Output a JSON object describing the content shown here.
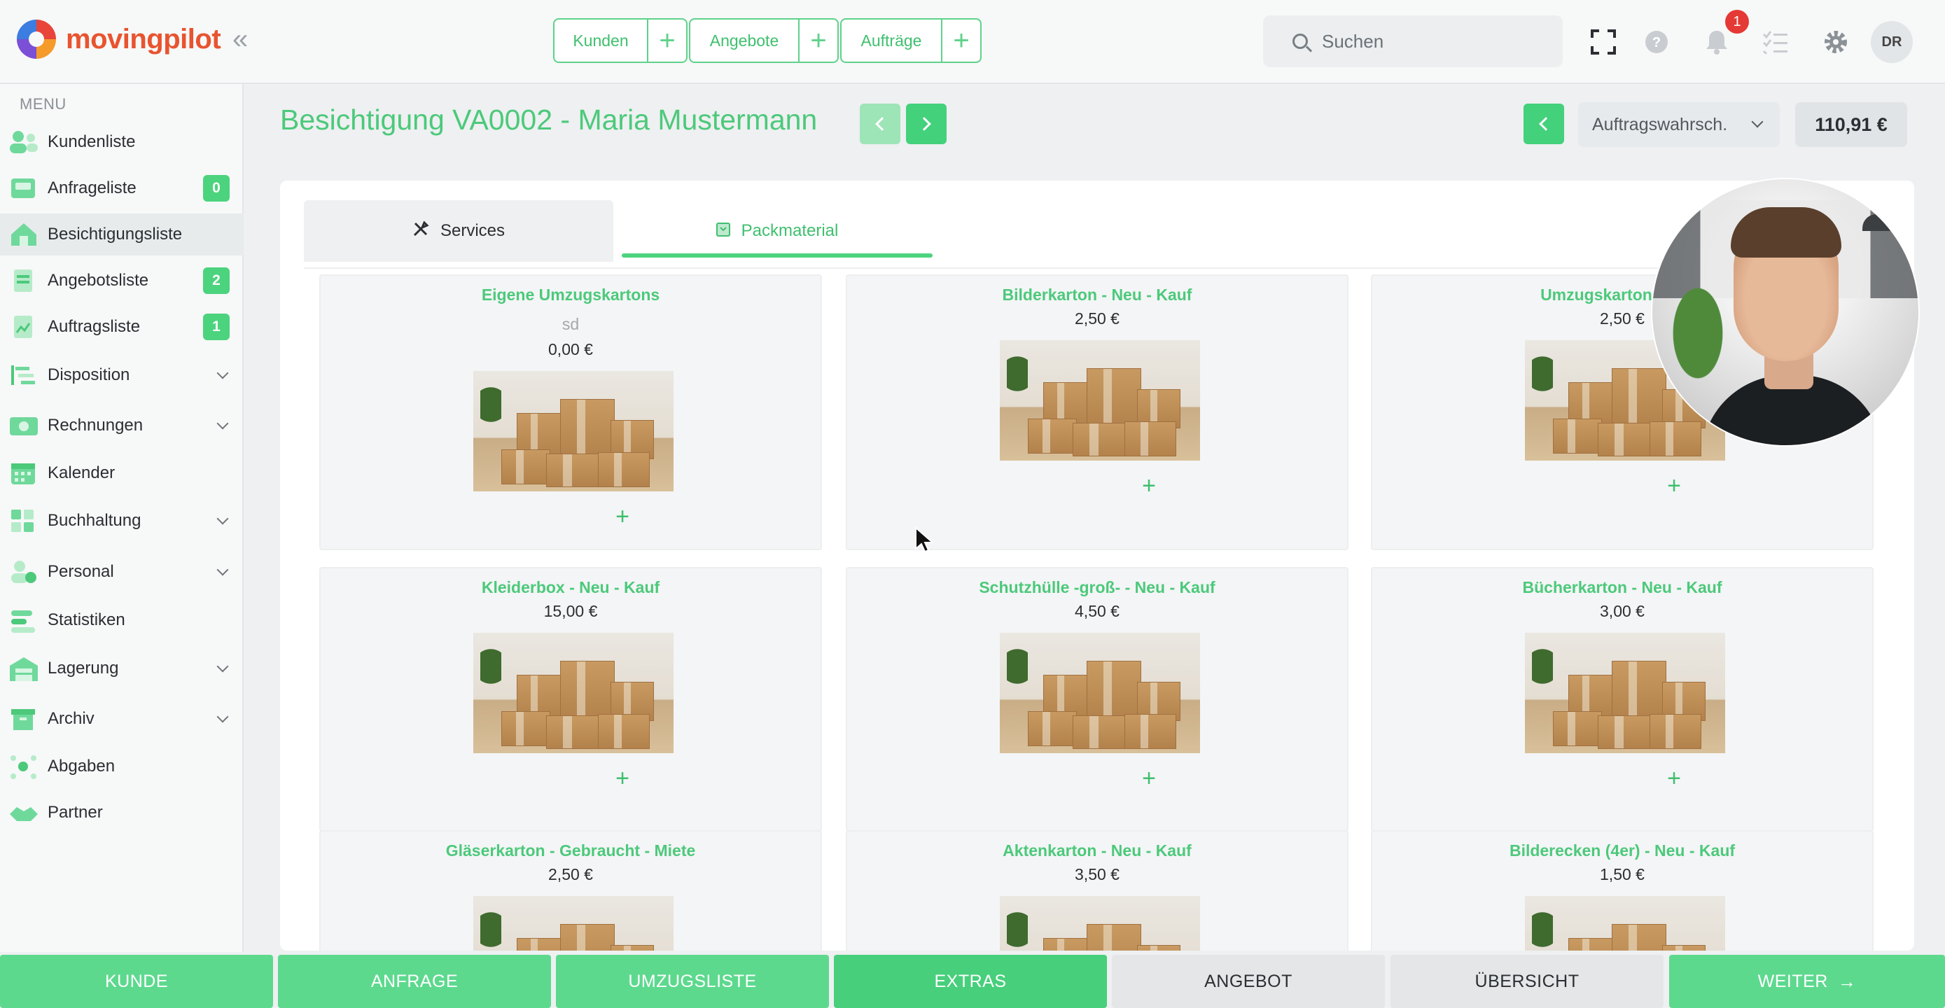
{
  "app": {
    "logo_text": "movingpilot",
    "collapse_glyph": "«"
  },
  "quick_nav": [
    {
      "label": "Kunden",
      "plus": "+"
    },
    {
      "label": "Angebote",
      "plus": "+"
    },
    {
      "label": "Aufträge",
      "plus": "+"
    }
  ],
  "search": {
    "placeholder": "Suchen"
  },
  "header_icons": {
    "fullscreen": "fullscreen-icon",
    "help": "help-icon",
    "bell": "bell-icon",
    "tasks": "tasklist-icon",
    "settings": "gear-icon"
  },
  "notifications": {
    "count": "1"
  },
  "user": {
    "initials": "DR"
  },
  "sidebar": {
    "menu_title": "MENU",
    "items": [
      {
        "label": "Kundenliste",
        "count": null,
        "chevron": false
      },
      {
        "label": "Anfrageliste",
        "count": "0",
        "chevron": false
      },
      {
        "label": "Besichtigungsliste",
        "count": null,
        "chevron": false,
        "active": true
      },
      {
        "label": "Angebotsliste",
        "count": "2",
        "chevron": false
      },
      {
        "label": "Auftragsliste",
        "count": "1",
        "chevron": false
      },
      {
        "label": "Disposition",
        "count": null,
        "chevron": true
      },
      {
        "label": "Rechnungen",
        "count": null,
        "chevron": true
      },
      {
        "label": "Kalender",
        "count": null,
        "chevron": false
      },
      {
        "label": "Buchhaltung",
        "count": null,
        "chevron": true
      },
      {
        "label": "Personal",
        "count": null,
        "chevron": true
      },
      {
        "label": "Statistiken",
        "count": null,
        "chevron": false
      },
      {
        "label": "Lagerung",
        "count": null,
        "chevron": true
      },
      {
        "label": "Archiv",
        "count": null,
        "chevron": true
      },
      {
        "label": "Abgaben",
        "count": null,
        "chevron": false
      },
      {
        "label": "Partner",
        "count": null,
        "chevron": false
      }
    ]
  },
  "page": {
    "title": "Besichtigung VA0002 - Maria Mustermann",
    "probability_select": "Auftragswahrsch.",
    "total_price": "110,91 €"
  },
  "tabs": [
    {
      "label": "Services",
      "active": false
    },
    {
      "label": "Packmaterial",
      "active": true
    }
  ],
  "products": [
    {
      "name": "Eigene Umzugskartons",
      "desc": "sd",
      "price": "0,00 €"
    },
    {
      "name": "Bilderkarton - Neu - Kauf",
      "desc": null,
      "price": "2,50 €"
    },
    {
      "name": "Umzugskarton - Gebr",
      "desc": null,
      "price": "2,50 €"
    },
    {
      "name": "Kleiderbox - Neu - Kauf",
      "desc": null,
      "price": "15,00 €"
    },
    {
      "name": "Schutzhülle -groß- - Neu - Kauf",
      "desc": null,
      "price": "4,50 €"
    },
    {
      "name": "Bücherkarton - Neu - Kauf",
      "desc": null,
      "price": "3,00 €"
    },
    {
      "name": "Gläserkarton - Gebraucht - Miete",
      "desc": null,
      "price": "2,50 €"
    },
    {
      "name": "Aktenkarton - Neu - Kauf",
      "desc": null,
      "price": "3,50 €"
    },
    {
      "name": "Bilderecken (4er) - Neu - Kauf",
      "desc": null,
      "price": "1,50 €"
    }
  ],
  "add_glyph": "+",
  "steps": [
    {
      "label": "KUNDE",
      "state": "done"
    },
    {
      "label": "ANFRAGE",
      "state": "done"
    },
    {
      "label": "UMZUGSLISTE",
      "state": "done"
    },
    {
      "label": "EXTRAS",
      "state": "current"
    },
    {
      "label": "ANGEBOT",
      "state": "todo"
    },
    {
      "label": "ÜBERSICHT",
      "state": "todo"
    },
    {
      "label": "WEITER",
      "state": "done",
      "arrow": "→"
    }
  ],
  "colors": {
    "accent": "#4cd37e",
    "accent_text": "#4cc97b",
    "brand": "#e8542f",
    "notification": "#e53935"
  }
}
